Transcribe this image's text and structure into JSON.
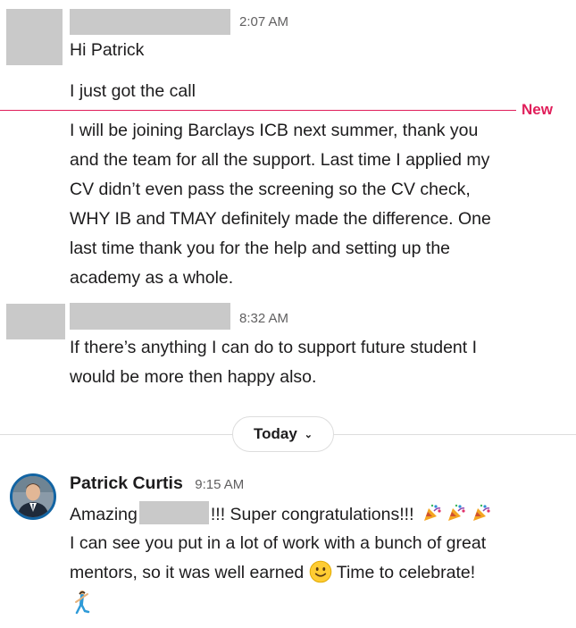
{
  "messages": [
    {
      "time": "2:07 AM",
      "lines": [
        "Hi Patrick"
      ]
    },
    {
      "lines": [
        "I just got the call"
      ]
    },
    {
      "lines": [
        "I will be joining Barclays ICB next summer, thank you",
        "and the team for all the support. Last time I applied  my",
        "CV didn’t even pass the screening so the CV check,",
        "WHY IB and TMAY definitely made the difference. One",
        "last time thank you for the help and setting up the",
        "academy as a whole."
      ]
    },
    {
      "time": "8:32 AM",
      "lines": [
        "If there’s anything I can do to support future student I",
        "would be more then happy also."
      ]
    }
  ],
  "new_divider": {
    "label": "New"
  },
  "day_divider": {
    "label": "Today"
  },
  "reply": {
    "author": "Patrick Curtis",
    "time": "9:15 AM",
    "line1_prefix": "Amazing",
    "line1_suffix": "!!! Super congratulations!!!",
    "line2": "I can see you put in a lot of work with a bunch of great",
    "line3_prefix": "mentors, so it was well earned",
    "line3_suffix": "Time to celebrate!"
  },
  "colors": {
    "new_accent": "#e01e5a",
    "avatar_ring": "#1264a3",
    "redaction": "#c9c9c9"
  },
  "icons": {
    "party": "party-popper-icon",
    "smile": "slightly-smiling-face-icon",
    "dance": "dancer-icon",
    "chevron": "chevron-down-icon"
  }
}
